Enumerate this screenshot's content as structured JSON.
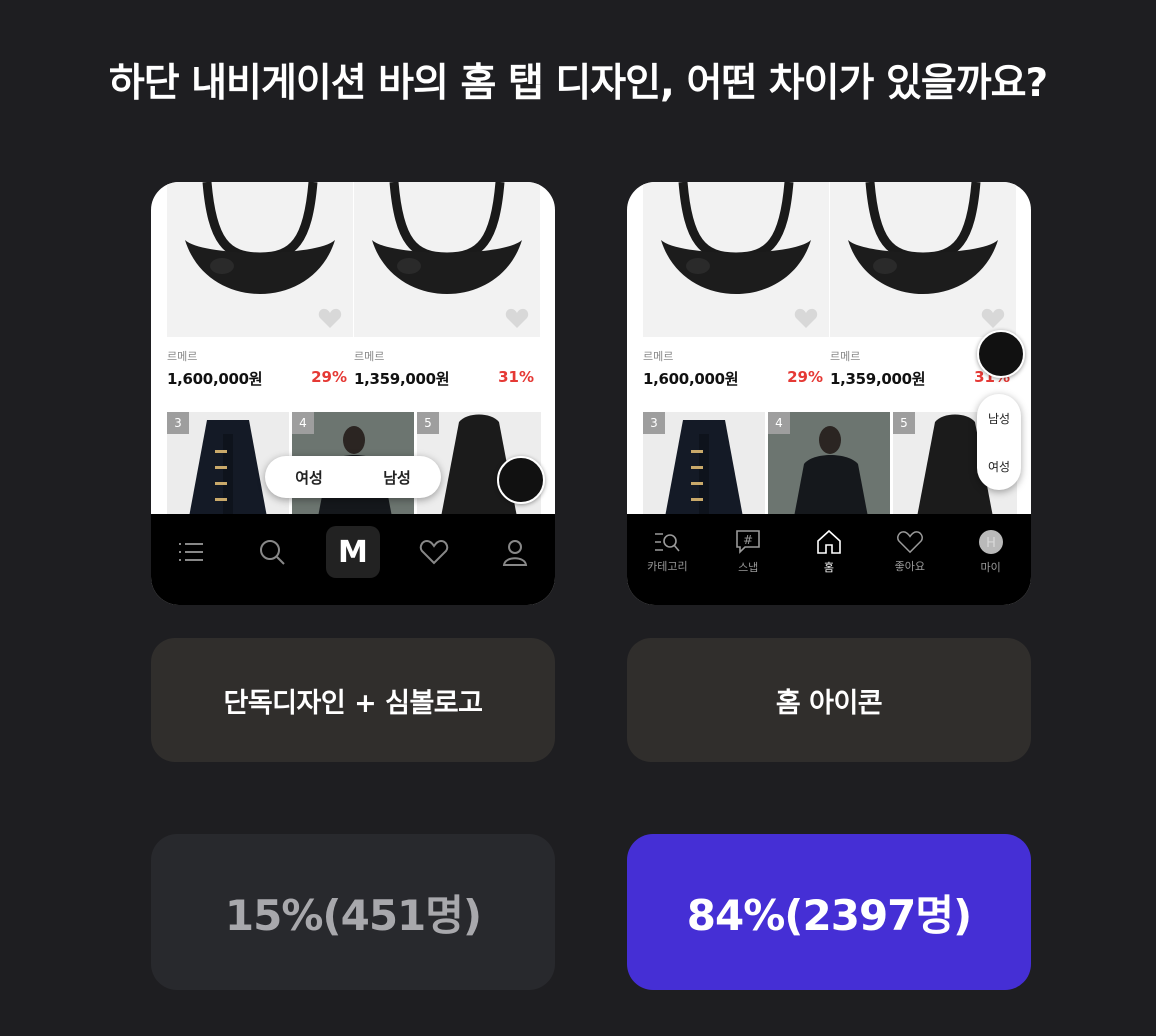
{
  "title": "하단 내비게이션 바의 홈 탭 디자인, 어떤 차이가 있을까요?",
  "colors": {
    "background": "#1e1e21",
    "winner_accent": "#452fd5",
    "discount_red": "#e53935"
  },
  "options": [
    {
      "products": [
        {
          "brand": "르메르",
          "price": "1,600,000원",
          "discount": "29%"
        },
        {
          "brand": "르메르",
          "price": "1,359,000원",
          "discount": "31%"
        }
      ],
      "ranks": [
        "3",
        "4",
        "5"
      ],
      "toggle": {
        "women": "여성",
        "men": "남성"
      },
      "nav": [
        {
          "icon": "menu-icon",
          "label": ""
        },
        {
          "icon": "search-icon",
          "label": ""
        },
        {
          "icon": "m-logo-icon",
          "label": "M"
        },
        {
          "icon": "heart-icon",
          "label": ""
        },
        {
          "icon": "person-icon",
          "label": ""
        }
      ],
      "label": "단독디자인 + 심볼로고",
      "result": "15%(451명)",
      "percent": 15,
      "votes": 451
    },
    {
      "products": [
        {
          "brand": "르메르",
          "price": "1,600,000원",
          "discount": "29%"
        },
        {
          "brand": "르메르",
          "price": "1,359,000원",
          "discount": "31%"
        }
      ],
      "ranks": [
        "3",
        "4",
        "5"
      ],
      "toggle": {
        "men": "남성",
        "women": "여성"
      },
      "nav": [
        {
          "icon": "category-icon",
          "label": "카테고리"
        },
        {
          "icon": "snap-icon",
          "label": "스냅"
        },
        {
          "icon": "home-icon",
          "label": "홈"
        },
        {
          "icon": "heart-icon",
          "label": "좋아요"
        },
        {
          "icon": "avatar-icon",
          "label": "마이"
        }
      ],
      "label": "홈 아이콘",
      "result": "84%(2397명)",
      "percent": 84,
      "votes": 2397
    }
  ]
}
